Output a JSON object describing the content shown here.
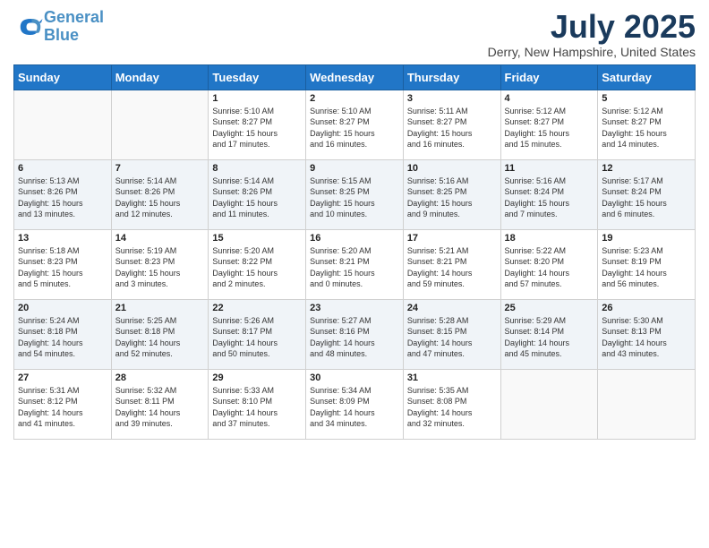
{
  "header": {
    "logo_line1": "General",
    "logo_line2": "Blue",
    "month_title": "July 2025",
    "location": "Derry, New Hampshire, United States"
  },
  "days_of_week": [
    "Sunday",
    "Monday",
    "Tuesday",
    "Wednesday",
    "Thursday",
    "Friday",
    "Saturday"
  ],
  "weeks": [
    [
      {
        "num": "",
        "info": ""
      },
      {
        "num": "",
        "info": ""
      },
      {
        "num": "1",
        "info": "Sunrise: 5:10 AM\nSunset: 8:27 PM\nDaylight: 15 hours\nand 17 minutes."
      },
      {
        "num": "2",
        "info": "Sunrise: 5:10 AM\nSunset: 8:27 PM\nDaylight: 15 hours\nand 16 minutes."
      },
      {
        "num": "3",
        "info": "Sunrise: 5:11 AM\nSunset: 8:27 PM\nDaylight: 15 hours\nand 16 minutes."
      },
      {
        "num": "4",
        "info": "Sunrise: 5:12 AM\nSunset: 8:27 PM\nDaylight: 15 hours\nand 15 minutes."
      },
      {
        "num": "5",
        "info": "Sunrise: 5:12 AM\nSunset: 8:27 PM\nDaylight: 15 hours\nand 14 minutes."
      }
    ],
    [
      {
        "num": "6",
        "info": "Sunrise: 5:13 AM\nSunset: 8:26 PM\nDaylight: 15 hours\nand 13 minutes."
      },
      {
        "num": "7",
        "info": "Sunrise: 5:14 AM\nSunset: 8:26 PM\nDaylight: 15 hours\nand 12 minutes."
      },
      {
        "num": "8",
        "info": "Sunrise: 5:14 AM\nSunset: 8:26 PM\nDaylight: 15 hours\nand 11 minutes."
      },
      {
        "num": "9",
        "info": "Sunrise: 5:15 AM\nSunset: 8:25 PM\nDaylight: 15 hours\nand 10 minutes."
      },
      {
        "num": "10",
        "info": "Sunrise: 5:16 AM\nSunset: 8:25 PM\nDaylight: 15 hours\nand 9 minutes."
      },
      {
        "num": "11",
        "info": "Sunrise: 5:16 AM\nSunset: 8:24 PM\nDaylight: 15 hours\nand 7 minutes."
      },
      {
        "num": "12",
        "info": "Sunrise: 5:17 AM\nSunset: 8:24 PM\nDaylight: 15 hours\nand 6 minutes."
      }
    ],
    [
      {
        "num": "13",
        "info": "Sunrise: 5:18 AM\nSunset: 8:23 PM\nDaylight: 15 hours\nand 5 minutes."
      },
      {
        "num": "14",
        "info": "Sunrise: 5:19 AM\nSunset: 8:23 PM\nDaylight: 15 hours\nand 3 minutes."
      },
      {
        "num": "15",
        "info": "Sunrise: 5:20 AM\nSunset: 8:22 PM\nDaylight: 15 hours\nand 2 minutes."
      },
      {
        "num": "16",
        "info": "Sunrise: 5:20 AM\nSunset: 8:21 PM\nDaylight: 15 hours\nand 0 minutes."
      },
      {
        "num": "17",
        "info": "Sunrise: 5:21 AM\nSunset: 8:21 PM\nDaylight: 14 hours\nand 59 minutes."
      },
      {
        "num": "18",
        "info": "Sunrise: 5:22 AM\nSunset: 8:20 PM\nDaylight: 14 hours\nand 57 minutes."
      },
      {
        "num": "19",
        "info": "Sunrise: 5:23 AM\nSunset: 8:19 PM\nDaylight: 14 hours\nand 56 minutes."
      }
    ],
    [
      {
        "num": "20",
        "info": "Sunrise: 5:24 AM\nSunset: 8:18 PM\nDaylight: 14 hours\nand 54 minutes."
      },
      {
        "num": "21",
        "info": "Sunrise: 5:25 AM\nSunset: 8:18 PM\nDaylight: 14 hours\nand 52 minutes."
      },
      {
        "num": "22",
        "info": "Sunrise: 5:26 AM\nSunset: 8:17 PM\nDaylight: 14 hours\nand 50 minutes."
      },
      {
        "num": "23",
        "info": "Sunrise: 5:27 AM\nSunset: 8:16 PM\nDaylight: 14 hours\nand 48 minutes."
      },
      {
        "num": "24",
        "info": "Sunrise: 5:28 AM\nSunset: 8:15 PM\nDaylight: 14 hours\nand 47 minutes."
      },
      {
        "num": "25",
        "info": "Sunrise: 5:29 AM\nSunset: 8:14 PM\nDaylight: 14 hours\nand 45 minutes."
      },
      {
        "num": "26",
        "info": "Sunrise: 5:30 AM\nSunset: 8:13 PM\nDaylight: 14 hours\nand 43 minutes."
      }
    ],
    [
      {
        "num": "27",
        "info": "Sunrise: 5:31 AM\nSunset: 8:12 PM\nDaylight: 14 hours\nand 41 minutes."
      },
      {
        "num": "28",
        "info": "Sunrise: 5:32 AM\nSunset: 8:11 PM\nDaylight: 14 hours\nand 39 minutes."
      },
      {
        "num": "29",
        "info": "Sunrise: 5:33 AM\nSunset: 8:10 PM\nDaylight: 14 hours\nand 37 minutes."
      },
      {
        "num": "30",
        "info": "Sunrise: 5:34 AM\nSunset: 8:09 PM\nDaylight: 14 hours\nand 34 minutes."
      },
      {
        "num": "31",
        "info": "Sunrise: 5:35 AM\nSunset: 8:08 PM\nDaylight: 14 hours\nand 32 minutes."
      },
      {
        "num": "",
        "info": ""
      },
      {
        "num": "",
        "info": ""
      }
    ]
  ]
}
